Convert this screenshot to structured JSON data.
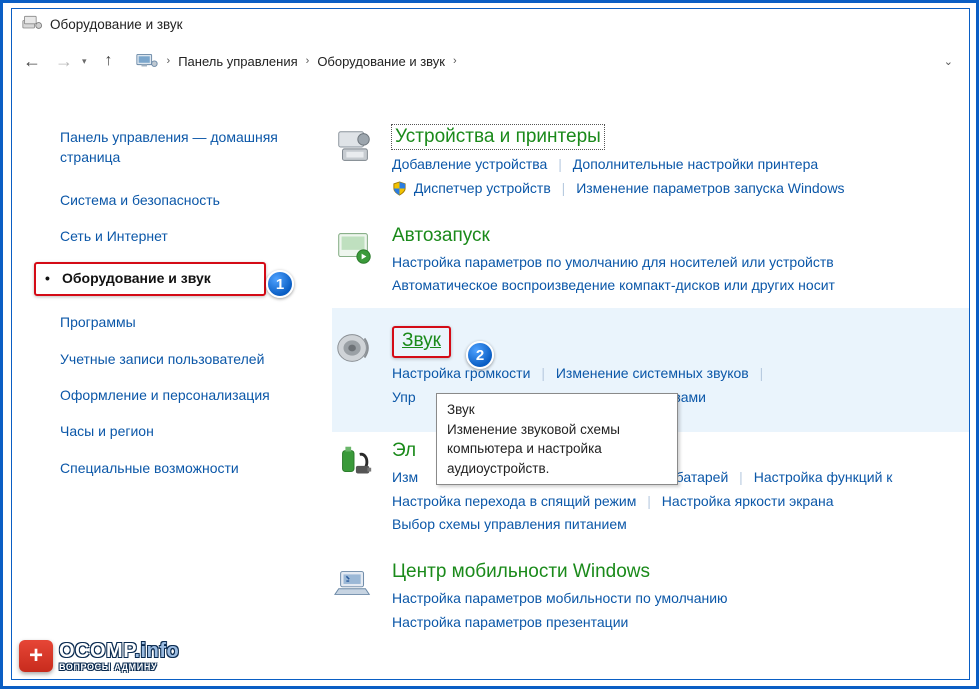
{
  "window": {
    "title": "Оборудование и звук"
  },
  "breadcrumb": {
    "items": [
      "Панель управления",
      "Оборудование и звук"
    ]
  },
  "sidebar": {
    "home": "Панель управления — домашняя страница",
    "items": [
      {
        "label": "Система и безопасность"
      },
      {
        "label": "Сеть и Интернет"
      },
      {
        "label": "Оборудование и звук",
        "current": true
      },
      {
        "label": "Программы"
      },
      {
        "label": "Учетные записи пользователей"
      },
      {
        "label": "Оформление и персонализация"
      },
      {
        "label": "Часы и регион"
      },
      {
        "label": "Специальные возможности"
      }
    ]
  },
  "main": {
    "categories": [
      {
        "title": "Устройства и принтеры",
        "links": [
          {
            "label": "Добавление устройства"
          },
          {
            "label": "Дополнительные настройки принтера"
          },
          {
            "label": "Диспетчер устройств",
            "shield": true
          },
          {
            "label": "Изменение параметров запуска Windows"
          }
        ]
      },
      {
        "title": "Автозапуск",
        "links": [
          {
            "label": "Настройка параметров по умолчанию для носителей или устройств"
          },
          {
            "label": "Автоматическое воспроизведение компакт-дисков или других носит"
          }
        ]
      },
      {
        "title": "Звук",
        "highlight": true,
        "links": [
          {
            "label": "Настройка громкости"
          },
          {
            "label": "Изменение системных звуков"
          },
          {
            "label": "Упр"
          },
          {
            "label": "вами",
            "tail": true
          }
        ]
      },
      {
        "title": "Эл",
        "links": [
          {
            "label": "Изм"
          },
          {
            "label": "от батарей",
            "tail": true
          },
          {
            "label": "Настройка функций к"
          },
          {
            "label": "Настройка перехода в спящий режим"
          },
          {
            "label": "Настройка яркости экрана"
          },
          {
            "label": "Выбор схемы управления питанием"
          }
        ]
      },
      {
        "title": "Центр мобильности Windows",
        "links": [
          {
            "label": "Настройка параметров мобильности по умолчанию"
          },
          {
            "label": "Настройка параметров презентации"
          }
        ]
      }
    ]
  },
  "markers": {
    "1": "1",
    "2": "2"
  },
  "tooltip": {
    "title": "Звук",
    "body": "Изменение звуковой схемы компьютера и настройка аудиоустройств."
  },
  "watermark": {
    "brand_main": "OCOMP",
    "brand_suffix": ".info",
    "sub": "ВОПРОСЫ АДМИНУ"
  }
}
